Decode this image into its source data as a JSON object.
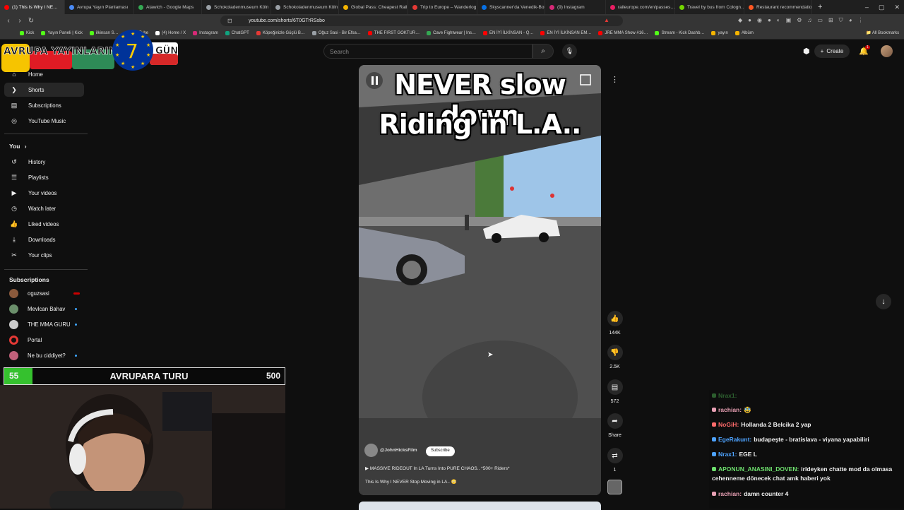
{
  "browser": {
    "tabs": [
      {
        "title": "(1) This Is Why I NE…",
        "color": "#ff0000"
      },
      {
        "title": "Avrupa Yayın Planlaması",
        "color": "#4a8af4"
      },
      {
        "title": "Atawich - Google Maps",
        "color": "#34a853"
      },
      {
        "title": "Schokoladenmuseum Köln",
        "color": "#9aa0a6"
      },
      {
        "title": "Schokoladenmuseum Köln",
        "color": "#9aa0a6"
      },
      {
        "title": "Global Pass: Cheapest Rail",
        "color": "#f4b400"
      },
      {
        "title": "Trip to Europe – Wanderlog",
        "color": "#e53935"
      },
      {
        "title": "Skyscanner'da Venedik-Bol…",
        "color": "#0770e3"
      },
      {
        "title": "(9) Instagram",
        "color": "#d62976"
      },
      {
        "title": "raileurope.com/en/passes…",
        "color": "#e91e63"
      },
      {
        "title": "Travel by bus from Cologn…",
        "color": "#73d700"
      },
      {
        "title": "Restaurant recommendatio…",
        "color": "#ff5722"
      }
    ],
    "new_tab": "+",
    "url": "youtube.com/shorts/6T0GTrRSsbo",
    "bookmarks": [
      {
        "label": "Kick",
        "color": "#53fc18"
      },
      {
        "label": "Yayın Paneli | Kick",
        "color": "#53fc18"
      },
      {
        "label": "ilkinsan S…",
        "color": "#53fc18"
      },
      {
        "label": "YouTube",
        "color": "#ff0000"
      },
      {
        "label": "(4) Home / X",
        "color": "#ffffff"
      },
      {
        "label": "Instagram",
        "color": "#d62976"
      },
      {
        "label": "ChatGPT",
        "color": "#10a37f"
      },
      {
        "label": "Köpeğinizle Güçlü B…",
        "color": "#e53935"
      },
      {
        "label": "Oğuz Sasi - Bir Efsa…",
        "color": "#9aa0a6"
      },
      {
        "label": "THE FIRST GOKTUR…",
        "color": "#ff0000"
      },
      {
        "label": "Cave Fightwear | Ins…",
        "color": "#34a853"
      },
      {
        "label": "EN İYİ İLKİNSAN - Q…",
        "color": "#ff0000"
      },
      {
        "label": "EN İYİ İLKİNSAN EM…",
        "color": "#ff0000"
      },
      {
        "label": "JRE MMA Show #16…",
        "color": "#ff0000"
      },
      {
        "label": "Stream - Kick Dashb…",
        "color": "#53fc18"
      },
      {
        "label": "yayın",
        "color": "#f4b400"
      },
      {
        "label": "Albüm",
        "color": "#f4b400"
      }
    ],
    "all_bookmarks": "All Bookmarks"
  },
  "overlay": {
    "banner_text": "AVRUPA YAYINLARINA",
    "day_number": "7",
    "day_suffix": "GÜN"
  },
  "header": {
    "search_placeholder": "Search",
    "create_label": "Create",
    "notif_count": "1"
  },
  "sidebar": {
    "items": [
      {
        "label": "Home",
        "icon": "home-icon",
        "glyph": "⌂"
      },
      {
        "label": "Shorts",
        "icon": "shorts-icon",
        "glyph": "❯"
      },
      {
        "label": "Subscriptions",
        "icon": "subscriptions-icon",
        "glyph": "▤"
      },
      {
        "label": "YouTube Music",
        "icon": "music-icon",
        "glyph": "◎"
      }
    ],
    "you_heading": "You",
    "you_items": [
      {
        "label": "History",
        "icon": "history-icon",
        "glyph": "↺"
      },
      {
        "label": "Playlists",
        "icon": "playlists-icon",
        "glyph": "☰"
      },
      {
        "label": "Your videos",
        "icon": "your-videos-icon",
        "glyph": "▶"
      },
      {
        "label": "Watch later",
        "icon": "watch-later-icon",
        "glyph": "◷"
      },
      {
        "label": "Liked videos",
        "icon": "liked-icon",
        "glyph": "👍"
      },
      {
        "label": "Downloads",
        "icon": "downloads-icon",
        "glyph": "⤓"
      },
      {
        "label": "Your clips",
        "icon": "clips-icon",
        "glyph": "✂"
      }
    ],
    "subs_heading": "Subscriptions",
    "subs": [
      {
        "label": "oguzsasi",
        "color": "#8b5a3c",
        "indicator": "live"
      },
      {
        "label": "Mevlcan Bahav",
        "color": "#6b8f6b",
        "indicator": "dot"
      },
      {
        "label": "THE MMA GURU",
        "color": "#cccccc",
        "indicator": "dot"
      },
      {
        "label": "Portal",
        "color": "#e53935",
        "indicator": "none"
      },
      {
        "label": "Ne bu ciddiyet?",
        "color": "#c0607a",
        "indicator": "dot"
      }
    ]
  },
  "score": {
    "left": "55",
    "title": "AVRUPARA TURU",
    "right": "500"
  },
  "short": {
    "caption_line1": "NEVER slow down",
    "caption_line2": "Riding in L.A..",
    "channel": "@JohnHicksFilm",
    "subscribe": "Subscribe",
    "playlist": "MASSIVE RIDEOUT In LA Turns Into PURE CHAOS.. *500+ Riders*",
    "title": "This Is Why I NEVER Stop Moving in LA.. 😳",
    "likes": "144K",
    "dislikes": "2.5K",
    "comments": "572",
    "share": "Share",
    "remix": "1"
  },
  "chat": [
    {
      "nick": "Nrax1:",
      "text": "",
      "nick_color": "#4caf50"
    },
    {
      "nick": "rachian:",
      "text": "🥸",
      "nick_color": "#e8a0b4"
    },
    {
      "nick": "NoGiH:",
      "text": "Hollanda 2 Belcika 2 yap",
      "nick_color": "#ff6b6b"
    },
    {
      "nick": "EgeRakunt:",
      "text": "budapeşte - bratislava - viyana yapabiliri",
      "nick_color": "#4ea3ff"
    },
    {
      "nick": "Nrax1:",
      "text": "EGE L",
      "nick_color": "#4ea3ff"
    },
    {
      "nick": "APONUN_ANASINI_DOVEN:",
      "text": "irldeyken chatte mod da olmasa cehenneme dönecek chat amk haberi yok",
      "nick_color": "#6ee06e"
    },
    {
      "nick": "rachian:",
      "text": "damn counter 4",
      "nick_color": "#e8a0b4"
    }
  ]
}
